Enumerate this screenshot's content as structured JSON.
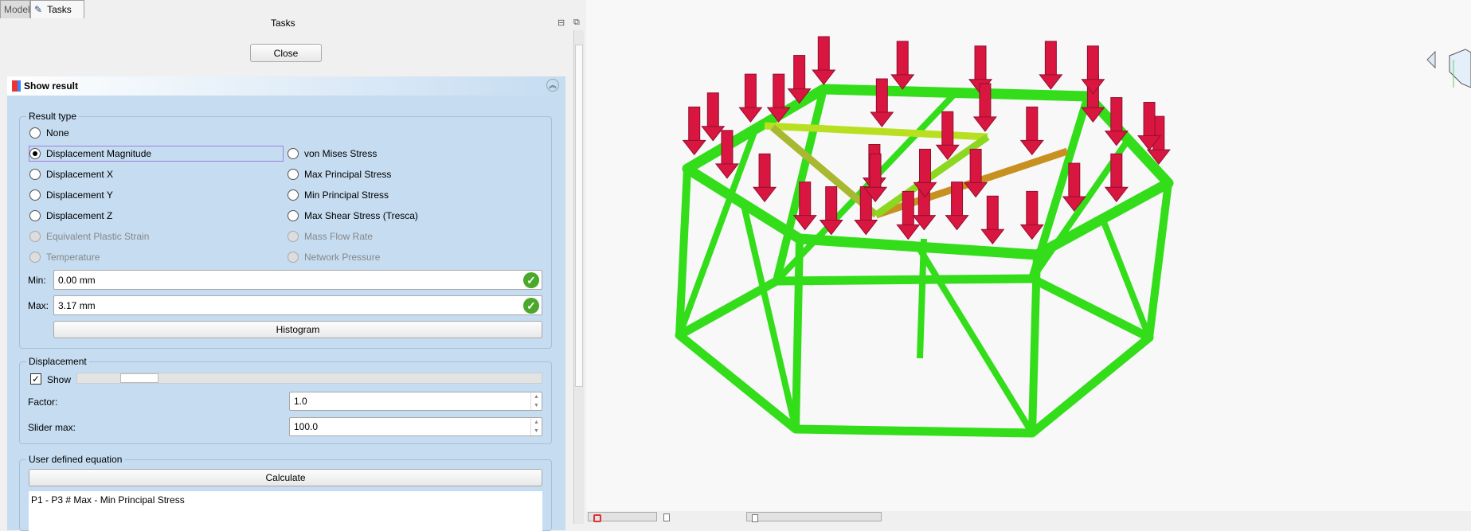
{
  "tabs": [
    {
      "label": "Model"
    },
    {
      "label": "Tasks"
    }
  ],
  "panel_title": "Tasks",
  "close_label": "Close",
  "task_title": "Show result",
  "result_type": {
    "legend": "Result type",
    "left": [
      {
        "label": "None",
        "checked": false,
        "enabled": true
      },
      {
        "label": "Displacement Magnitude",
        "checked": true,
        "enabled": true
      },
      {
        "label": "Displacement X",
        "checked": false,
        "enabled": true
      },
      {
        "label": "Displacement Y",
        "checked": false,
        "enabled": true
      },
      {
        "label": "Displacement Z",
        "checked": false,
        "enabled": true
      },
      {
        "label": "Equivalent Plastic Strain",
        "checked": false,
        "enabled": false
      },
      {
        "label": "Temperature",
        "checked": false,
        "enabled": false
      }
    ],
    "right": [
      {
        "label": "von Mises Stress",
        "enabled": true
      },
      {
        "label": "Max Principal Stress",
        "enabled": true
      },
      {
        "label": "Min Principal Stress",
        "enabled": true
      },
      {
        "label": "Max Shear Stress (Tresca)",
        "enabled": true
      },
      {
        "label": "Mass Flow Rate",
        "enabled": false
      },
      {
        "label": "Network Pressure",
        "enabled": false
      }
    ],
    "min_label": "Min:",
    "min_value": "0.00 mm",
    "max_label": "Max:",
    "max_value": "3.17 mm",
    "histogram_label": "Histogram"
  },
  "displacement": {
    "legend": "Displacement",
    "show_label": "Show",
    "show_checked": true,
    "slider_fraction": 0.08,
    "factor_label": "Factor:",
    "factor_value": "1.0",
    "slider_max_label": "Slider max:",
    "slider_max_value": "100.0"
  },
  "equation": {
    "legend": "User defined equation",
    "calculate_label": "Calculate",
    "text": "P1 - P3 # Max - Min Principal Stress"
  },
  "colors": {
    "panel": "#c5dcf1",
    "frame": "#33dd1a",
    "arrow": "#d8163f"
  }
}
